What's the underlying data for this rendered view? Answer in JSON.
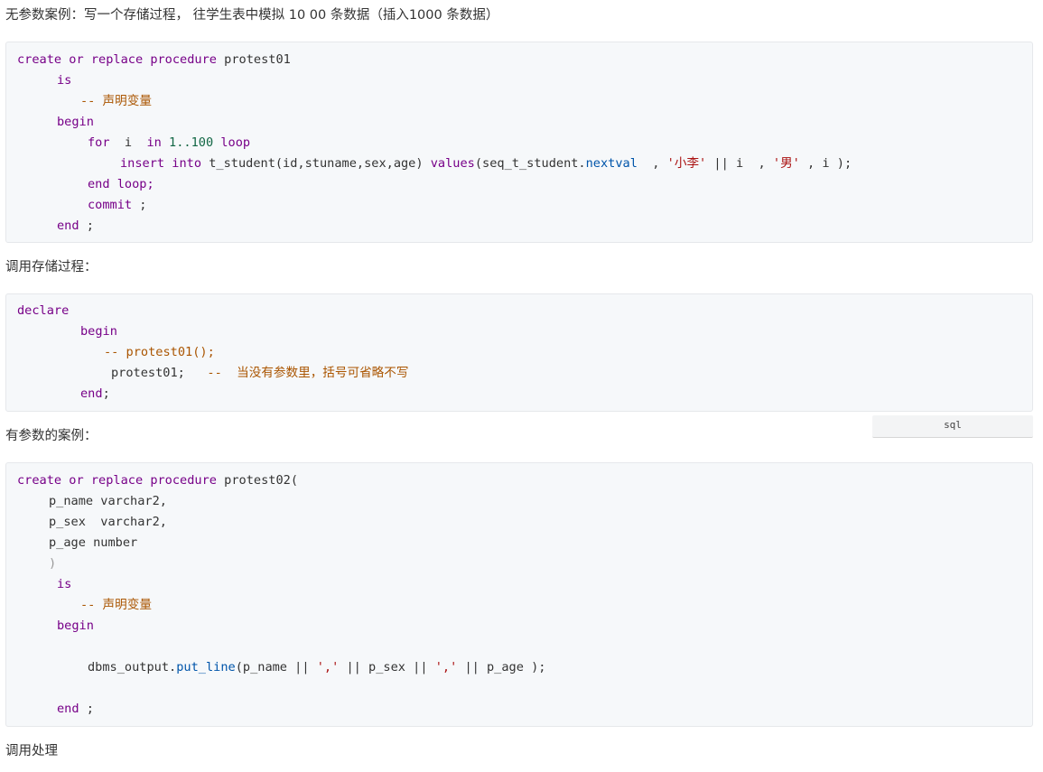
{
  "heading1": "无参数案例：写一个存储过程， 往学生表中模拟 10 00 条数据（插入1000  条数据）",
  "block1": {
    "l1_kw": "create or replace procedure",
    "l1_name": " protest01",
    "l2": "is",
    "l3": "-- 声明变量",
    "l4": "begin",
    "l5_for": "for",
    "l5_i": "  i  ",
    "l5_in": "in",
    "l5_range": " 1..100 ",
    "l5_loop": "loop",
    "l6_insert": "insert into",
    "l6_table": " t_student(id,stuname,sex,age) ",
    "l6_values": "values",
    "l6_seq": "(seq_t_student.",
    "l6_nextval": "nextval",
    "l6_c1": "  , ",
    "l6_s1": "'小李'",
    "l6_c2": " || i  , ",
    "l6_s2": "'男'",
    "l6_c3": " , i );",
    "l7_end": "end",
    "l7_loop": " loop;",
    "l8_commit": "commit",
    "l8_semi": " ;",
    "l9_end": "end",
    "l9_semi": " ;"
  },
  "heading2": "调用存储过程：",
  "block2": {
    "l1": "declare",
    "l2": "begin",
    "l3": "-- protest01();",
    "l4_call": "protest01;",
    "l4_cm": "--  当没有参数里，括号可省略不写",
    "l5_end": "end",
    "l5_semi": ";"
  },
  "lang_tag": "sql",
  "heading3": "有参数的案例：",
  "block3": {
    "l1_kw": "create or replace procedure",
    "l1_name": " protest02(",
    "l2": "p_name varchar2,",
    "l3": "p_sex  varchar2,",
    "l4": "p_age number",
    "l5": ")",
    "l6": "is",
    "l7": "-- 声明变量",
    "l8": "begin",
    "l10_obj": "dbms_output.",
    "l10_fn": "put_line",
    "l10_a": "(p_name || ",
    "l10_s1": "','",
    "l10_b": " || p_sex || ",
    "l10_s2": "','",
    "l10_c": " || p_age );",
    "l12_end": "end",
    "l12_semi": " ;"
  },
  "heading4": "调用处理",
  "colors": {
    "keyword": "#770088",
    "comment": "#aa5500",
    "string": "#aa1111",
    "number": "#116644",
    "function": "#0055aa",
    "code_bg": "#f6f8fa"
  }
}
